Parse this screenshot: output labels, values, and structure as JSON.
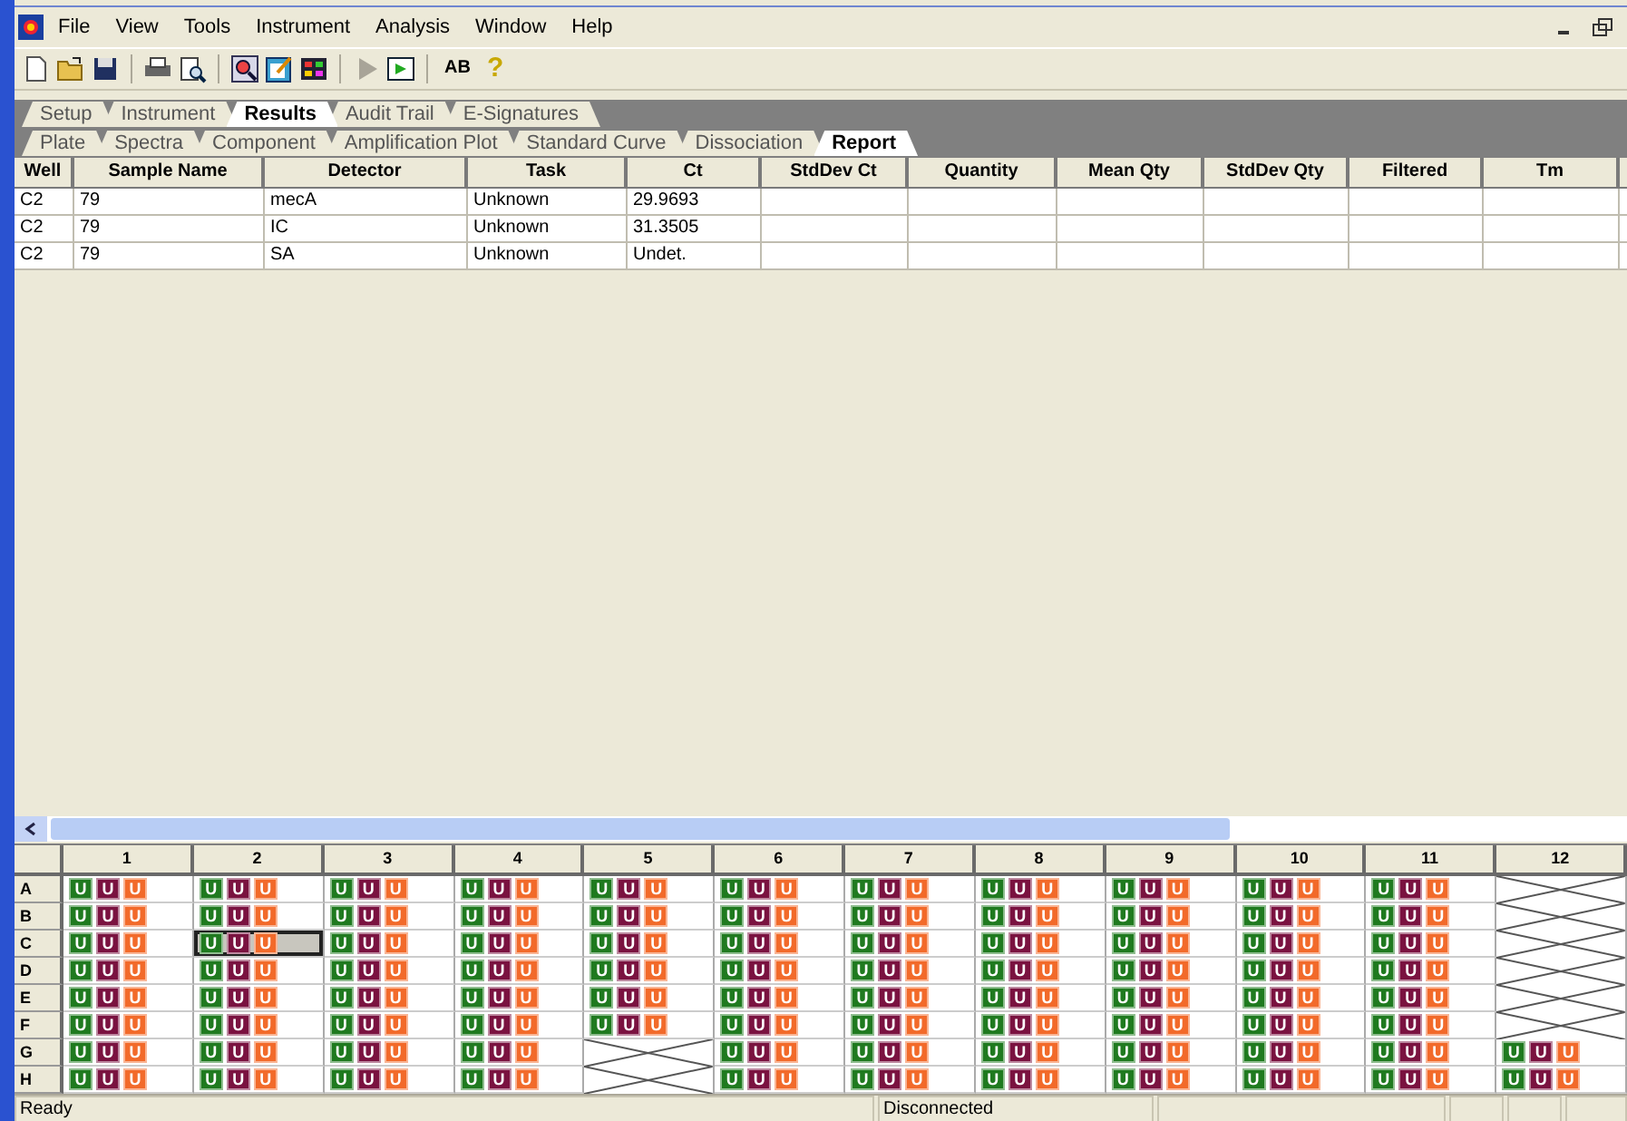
{
  "menu": [
    "File",
    "View",
    "Tools",
    "Instrument",
    "Analysis",
    "Window",
    "Help"
  ],
  "toolbar": {
    "play_disabled": true,
    "text_buttons": [
      "AB",
      "?"
    ]
  },
  "main_tabs": [
    {
      "label": "Setup",
      "selected": false
    },
    {
      "label": "Instrument",
      "selected": false
    },
    {
      "label": "Results",
      "selected": true
    },
    {
      "label": "Audit Trail",
      "selected": false
    },
    {
      "label": "E-Signatures",
      "selected": false
    }
  ],
  "sub_tabs": [
    {
      "label": "Plate",
      "selected": false
    },
    {
      "label": "Spectra",
      "selected": false
    },
    {
      "label": "Component",
      "selected": false
    },
    {
      "label": "Amplification Plot",
      "selected": false
    },
    {
      "label": "Standard Curve",
      "selected": false
    },
    {
      "label": "Dissociation",
      "selected": false
    },
    {
      "label": "Report",
      "selected": true
    }
  ],
  "table": {
    "columns": [
      "Well",
      "Sample Name",
      "Detector",
      "Task",
      "Ct",
      "StdDev Ct",
      "Quantity",
      "Mean Qty",
      "StdDev Qty",
      "Filtered",
      "Tm"
    ],
    "rows": [
      [
        "C2",
        "79",
        "mecA",
        "Unknown",
        "29.9693",
        "",
        "",
        "",
        "",
        "",
        ""
      ],
      [
        "C2",
        "79",
        "IC",
        "Unknown",
        "31.3505",
        "",
        "",
        "",
        "",
        "",
        ""
      ],
      [
        "C2",
        "79",
        "SA",
        "Unknown",
        "Undet.",
        "",
        "",
        "",
        "",
        "",
        ""
      ]
    ]
  },
  "plate": {
    "columns": [
      "1",
      "2",
      "3",
      "4",
      "5",
      "6",
      "7",
      "8",
      "9",
      "10",
      "11",
      "12"
    ],
    "detectors": [
      {
        "color": "#1f7a1f"
      },
      {
        "color": "#7a1240"
      },
      {
        "color": "#f26a2a"
      }
    ],
    "rows": [
      {
        "label": "A",
        "wells": [
          {
            "markers": [
              "U",
              "U",
              "U"
            ],
            "selected": false
          },
          {
            "markers": [
              "U",
              "U",
              "U"
            ],
            "selected": false
          },
          {
            "markers": [
              "U",
              "U",
              "U"
            ],
            "selected": false
          },
          {
            "markers": [
              "U",
              "U",
              "U"
            ],
            "selected": false
          },
          {
            "markers": [
              "U",
              "U",
              "U"
            ],
            "selected": false
          },
          {
            "markers": [
              "U",
              "U",
              "U"
            ],
            "selected": false
          },
          {
            "markers": [
              "U",
              "U",
              "U"
            ],
            "selected": false
          },
          {
            "markers": [
              "U",
              "U",
              "U"
            ],
            "selected": false
          },
          {
            "markers": [
              "U",
              "U",
              "U"
            ],
            "selected": false
          },
          {
            "markers": [
              "U",
              "U",
              "U"
            ],
            "selected": false
          },
          {
            "markers": [
              "U",
              "U",
              "U"
            ],
            "selected": false
          },
          {
            "empty": true,
            "selected": false
          }
        ]
      },
      {
        "label": "B",
        "wells": [
          {
            "markers": [
              "U",
              "U",
              "U"
            ],
            "selected": false
          },
          {
            "markers": [
              "U",
              "U",
              "U"
            ],
            "selected": false
          },
          {
            "markers": [
              "U",
              "U",
              "U"
            ],
            "selected": false
          },
          {
            "markers": [
              "U",
              "U",
              "U"
            ],
            "selected": false
          },
          {
            "markers": [
              "U",
              "U",
              "U"
            ],
            "selected": false
          },
          {
            "markers": [
              "U",
              "U",
              "U"
            ],
            "selected": false
          },
          {
            "markers": [
              "U",
              "U",
              "U"
            ],
            "selected": false
          },
          {
            "markers": [
              "U",
              "U",
              "U"
            ],
            "selected": false
          },
          {
            "markers": [
              "U",
              "U",
              "U"
            ],
            "selected": false
          },
          {
            "markers": [
              "U",
              "U",
              "U"
            ],
            "selected": false
          },
          {
            "markers": [
              "U",
              "U",
              "U"
            ],
            "selected": false
          },
          {
            "empty": true,
            "selected": false
          }
        ]
      },
      {
        "label": "C",
        "wells": [
          {
            "markers": [
              "U",
              "U",
              "U"
            ],
            "selected": false
          },
          {
            "markers": [
              "U",
              "U",
              "U"
            ],
            "selected": true
          },
          {
            "markers": [
              "U",
              "U",
              "U"
            ],
            "selected": false
          },
          {
            "markers": [
              "U",
              "U",
              "U"
            ],
            "selected": false
          },
          {
            "markers": [
              "U",
              "U",
              "U"
            ],
            "selected": false
          },
          {
            "markers": [
              "U",
              "U",
              "U"
            ],
            "selected": false
          },
          {
            "markers": [
              "U",
              "U",
              "U"
            ],
            "selected": false
          },
          {
            "markers": [
              "U",
              "U",
              "U"
            ],
            "selected": false
          },
          {
            "markers": [
              "U",
              "U",
              "U"
            ],
            "selected": false
          },
          {
            "markers": [
              "U",
              "U",
              "U"
            ],
            "selected": false
          },
          {
            "markers": [
              "U",
              "U",
              "U"
            ],
            "selected": false
          },
          {
            "empty": true,
            "selected": false
          }
        ]
      },
      {
        "label": "D",
        "wells": [
          {
            "markers": [
              "U",
              "U",
              "U"
            ],
            "selected": false
          },
          {
            "markers": [
              "U",
              "U",
              "U"
            ],
            "selected": false
          },
          {
            "markers": [
              "U",
              "U",
              "U"
            ],
            "selected": false
          },
          {
            "markers": [
              "U",
              "U",
              "U"
            ],
            "selected": false
          },
          {
            "markers": [
              "U",
              "U",
              "U"
            ],
            "selected": false
          },
          {
            "markers": [
              "U",
              "U",
              "U"
            ],
            "selected": false
          },
          {
            "markers": [
              "U",
              "U",
              "U"
            ],
            "selected": false
          },
          {
            "markers": [
              "U",
              "U",
              "U"
            ],
            "selected": false
          },
          {
            "markers": [
              "U",
              "U",
              "U"
            ],
            "selected": false
          },
          {
            "markers": [
              "U",
              "U",
              "U"
            ],
            "selected": false
          },
          {
            "markers": [
              "U",
              "U",
              "U"
            ],
            "selected": false
          },
          {
            "empty": true,
            "selected": false
          }
        ]
      },
      {
        "label": "E",
        "wells": [
          {
            "markers": [
              "U",
              "U",
              "U"
            ],
            "selected": false
          },
          {
            "markers": [
              "U",
              "U",
              "U"
            ],
            "selected": false
          },
          {
            "markers": [
              "U",
              "U",
              "U"
            ],
            "selected": false
          },
          {
            "markers": [
              "U",
              "U",
              "U"
            ],
            "selected": false
          },
          {
            "markers": [
              "U",
              "U",
              "U"
            ],
            "selected": false
          },
          {
            "markers": [
              "U",
              "U",
              "U"
            ],
            "selected": false
          },
          {
            "markers": [
              "U",
              "U",
              "U"
            ],
            "selected": false
          },
          {
            "markers": [
              "U",
              "U",
              "U"
            ],
            "selected": false
          },
          {
            "markers": [
              "U",
              "U",
              "U"
            ],
            "selected": false
          },
          {
            "markers": [
              "U",
              "U",
              "U"
            ],
            "selected": false
          },
          {
            "markers": [
              "U",
              "U",
              "U"
            ],
            "selected": false
          },
          {
            "empty": true,
            "selected": false
          }
        ]
      },
      {
        "label": "F",
        "wells": [
          {
            "markers": [
              "U",
              "U",
              "U"
            ],
            "selected": false
          },
          {
            "markers": [
              "U",
              "U",
              "U"
            ],
            "selected": false
          },
          {
            "markers": [
              "U",
              "U",
              "U"
            ],
            "selected": false
          },
          {
            "markers": [
              "U",
              "U",
              "U"
            ],
            "selected": false
          },
          {
            "markers": [
              "U",
              "U",
              "U"
            ],
            "selected": false
          },
          {
            "markers": [
              "U",
              "U",
              "U"
            ],
            "selected": false
          },
          {
            "markers": [
              "U",
              "U",
              "U"
            ],
            "selected": false
          },
          {
            "markers": [
              "U",
              "U",
              "U"
            ],
            "selected": false
          },
          {
            "markers": [
              "U",
              "U",
              "U"
            ],
            "selected": false
          },
          {
            "markers": [
              "U",
              "U",
              "U"
            ],
            "selected": false
          },
          {
            "markers": [
              "U",
              "U",
              "U"
            ],
            "selected": false
          },
          {
            "empty": true,
            "selected": false
          }
        ]
      },
      {
        "label": "G",
        "wells": [
          {
            "markers": [
              "U",
              "U",
              "U"
            ],
            "selected": false
          },
          {
            "markers": [
              "U",
              "U",
              "U"
            ],
            "selected": false
          },
          {
            "markers": [
              "U",
              "U",
              "U"
            ],
            "selected": false
          },
          {
            "markers": [
              "U",
              "U",
              "U"
            ],
            "selected": false
          },
          {
            "empty": true,
            "selected": false
          },
          {
            "markers": [
              "U",
              "U",
              "U"
            ],
            "selected": false
          },
          {
            "markers": [
              "U",
              "U",
              "U"
            ],
            "selected": false
          },
          {
            "markers": [
              "U",
              "U",
              "U"
            ],
            "selected": false
          },
          {
            "markers": [
              "U",
              "U",
              "U"
            ],
            "selected": false
          },
          {
            "markers": [
              "U",
              "U",
              "U"
            ],
            "selected": false
          },
          {
            "markers": [
              "U",
              "U",
              "U"
            ],
            "selected": false
          },
          {
            "markers": [
              "U",
              "U",
              "U"
            ],
            "selected": false
          }
        ]
      },
      {
        "label": "H",
        "wells": [
          {
            "markers": [
              "U",
              "U",
              "U"
            ],
            "selected": false
          },
          {
            "markers": [
              "U",
              "U",
              "U"
            ],
            "selected": false
          },
          {
            "markers": [
              "U",
              "U",
              "U"
            ],
            "selected": false
          },
          {
            "markers": [
              "U",
              "U",
              "U"
            ],
            "selected": false
          },
          {
            "empty": true,
            "selected": false
          },
          {
            "markers": [
              "U",
              "U",
              "U"
            ],
            "selected": false
          },
          {
            "markers": [
              "U",
              "U",
              "U"
            ],
            "selected": false
          },
          {
            "markers": [
              "U",
              "U",
              "U"
            ],
            "selected": false
          },
          {
            "markers": [
              "U",
              "U",
              "U"
            ],
            "selected": false
          },
          {
            "markers": [
              "U",
              "U",
              "U"
            ],
            "selected": false
          },
          {
            "markers": [
              "U",
              "U",
              "U"
            ],
            "selected": false
          },
          {
            "markers": [
              "U",
              "U",
              "U"
            ],
            "selected": false
          }
        ]
      }
    ]
  },
  "status_bar": {
    "message": "Ready",
    "connection": "Disconnected"
  }
}
